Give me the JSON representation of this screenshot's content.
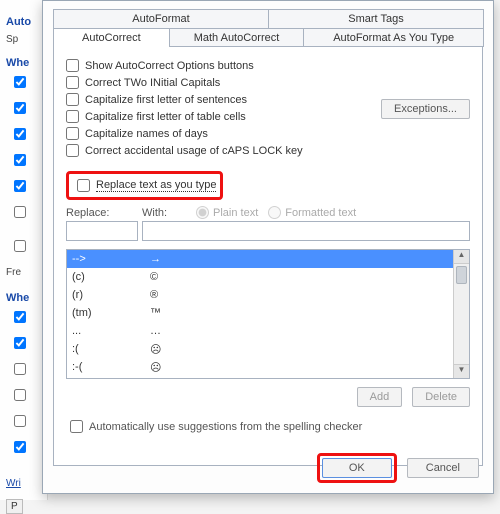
{
  "bg": {
    "header1": "Auto",
    "sp": "Sp",
    "whe1": "Whe",
    "fre": "Fre",
    "whe2": "Whe",
    "wri": "Wri",
    "p": "P"
  },
  "tabs": {
    "row1": [
      {
        "label": "AutoFormat"
      },
      {
        "label": "Smart Tags"
      }
    ],
    "row2": [
      {
        "label": "AutoCorrect",
        "active": true
      },
      {
        "label": "Math AutoCorrect"
      },
      {
        "label": "AutoFormat As You Type"
      }
    ]
  },
  "opts": {
    "show": "Show AutoCorrect Options buttons",
    "twocaps": "Correct TWo INitial Capitals",
    "sentences": "Capitalize first letter of sentences",
    "tablecells": "Capitalize first letter of table cells",
    "days": "Capitalize names of days",
    "capslock": "Correct accidental usage of cAPS LOCK key"
  },
  "exceptions_label": "Exceptions...",
  "replace_as_type": "Replace text as you type",
  "replace_label": "Replace:",
  "with_label": "With:",
  "plain_text": "Plain text",
  "formatted_text": "Formatted text",
  "table_rows": [
    {
      "from": "-->",
      "to": "→"
    },
    {
      "from": "(c)",
      "to": "©"
    },
    {
      "from": "(r)",
      "to": "®"
    },
    {
      "from": "(tm)",
      "to": "™"
    },
    {
      "from": "...",
      "to": "…"
    },
    {
      "from": ":(",
      "to": "☹"
    },
    {
      "from": ":-(",
      "to": "☹"
    }
  ],
  "add_label": "Add",
  "delete_label": "Delete",
  "auto_suggest": "Automatically use suggestions from the spelling checker",
  "ok_label": "OK",
  "cancel_label": "Cancel"
}
